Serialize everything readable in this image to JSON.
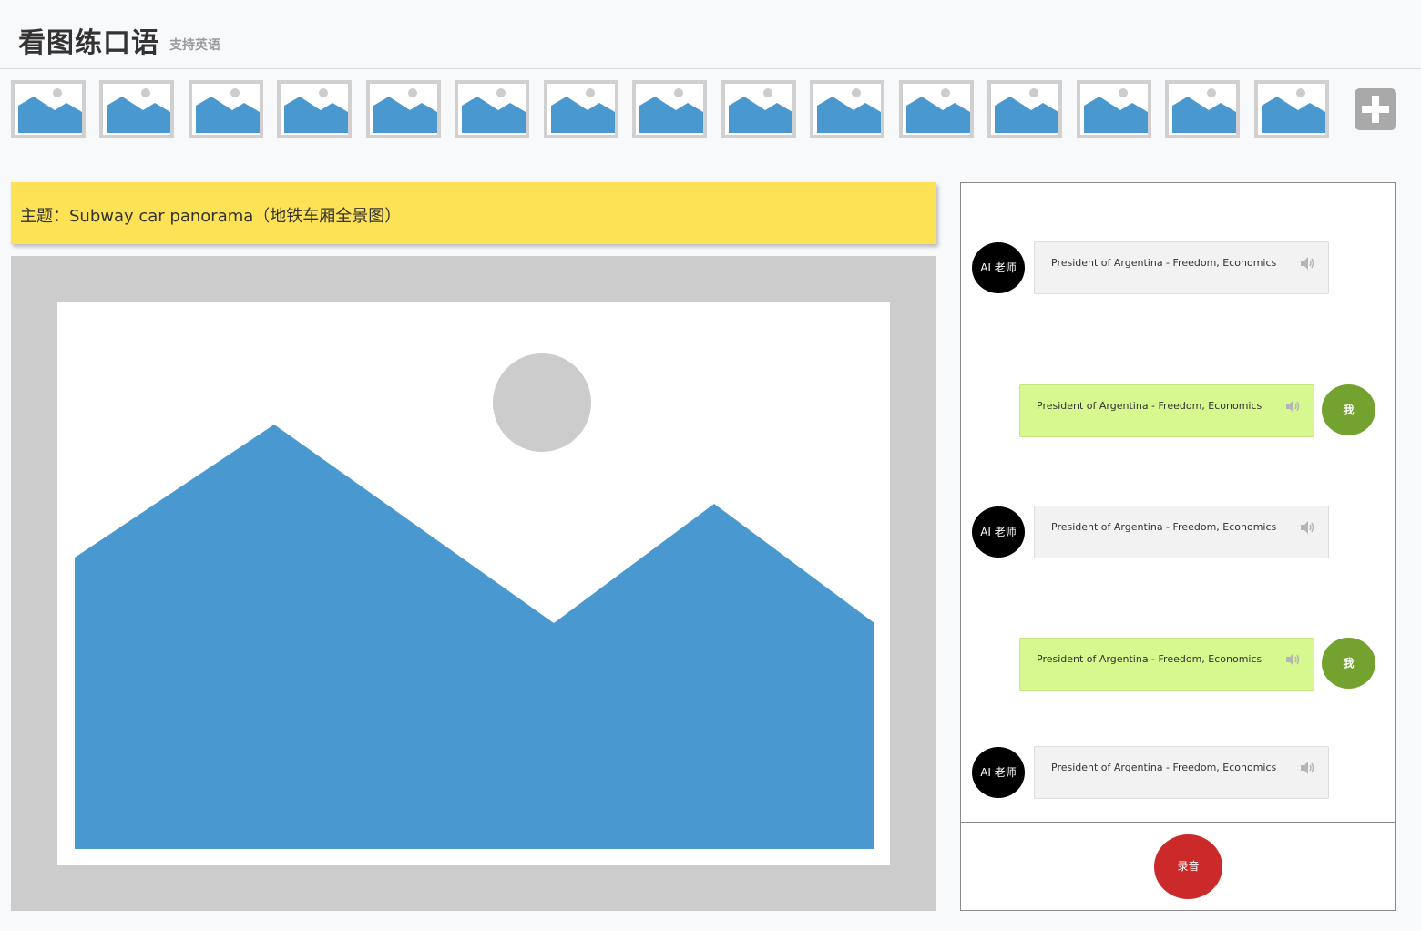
{
  "header": {
    "title": "看图练口语",
    "subtitle": "支持英语"
  },
  "thumbnails": {
    "icon": "image-placeholder-icon",
    "count": 15,
    "add_icon": "plus-icon"
  },
  "topic": {
    "text": "主题：Subway car panorama（地铁车厢全景图）"
  },
  "colors": {
    "topic_bg": "#fce254",
    "image_blue": "#4a98d0",
    "image_gray": "#cccccc",
    "ai_avatar": "#000000",
    "me_avatar": "#73a22e",
    "me_bubble": "#d6f88f",
    "ai_bubble": "#f2f2f2",
    "record": "#cc2a2a"
  },
  "chat": {
    "messages": [
      {
        "role": "ai",
        "avatar": "AI 老师",
        "text": "President of Argentina - Freedom, Economics"
      },
      {
        "role": "me",
        "avatar": "我",
        "text": "President of Argentina - Freedom, Economics"
      },
      {
        "role": "ai",
        "avatar": "AI 老师",
        "text": "President of Argentina - Freedom, Economics"
      },
      {
        "role": "me",
        "avatar": "我",
        "text": "President of Argentina - Freedom, Economics"
      },
      {
        "role": "ai",
        "avatar": "AI 老师",
        "text": "President of Argentina - Freedom, Economics"
      }
    ],
    "speaker_icon": "speaker-icon",
    "record_label": "录音"
  }
}
